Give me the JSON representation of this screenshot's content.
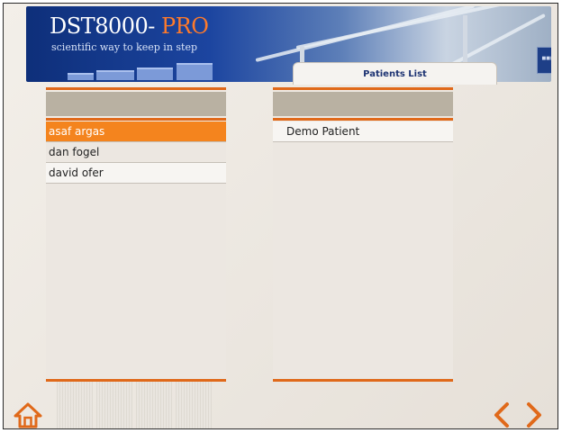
{
  "app": {
    "brand_main": "DST8000-",
    "brand_accent": "PRO",
    "tagline": "scientific way to keep in step"
  },
  "tab": {
    "title": "Patients List"
  },
  "left_list": {
    "items": [
      {
        "label": "asaf argas",
        "selected": true
      },
      {
        "label": "dan fogel",
        "selected": false
      },
      {
        "label": "david ofer",
        "selected": false
      }
    ]
  },
  "right_list": {
    "items": [
      {
        "label": "Demo Patient"
      }
    ]
  },
  "icons": {
    "home": "home-icon",
    "back": "chevron-left-icon",
    "forward": "chevron-right-icon"
  },
  "colors": {
    "accent": "#e0691a",
    "selected_row": "#f4841e",
    "banner_dark": "#0e2f7a",
    "header_band": "#b9b1a2"
  }
}
